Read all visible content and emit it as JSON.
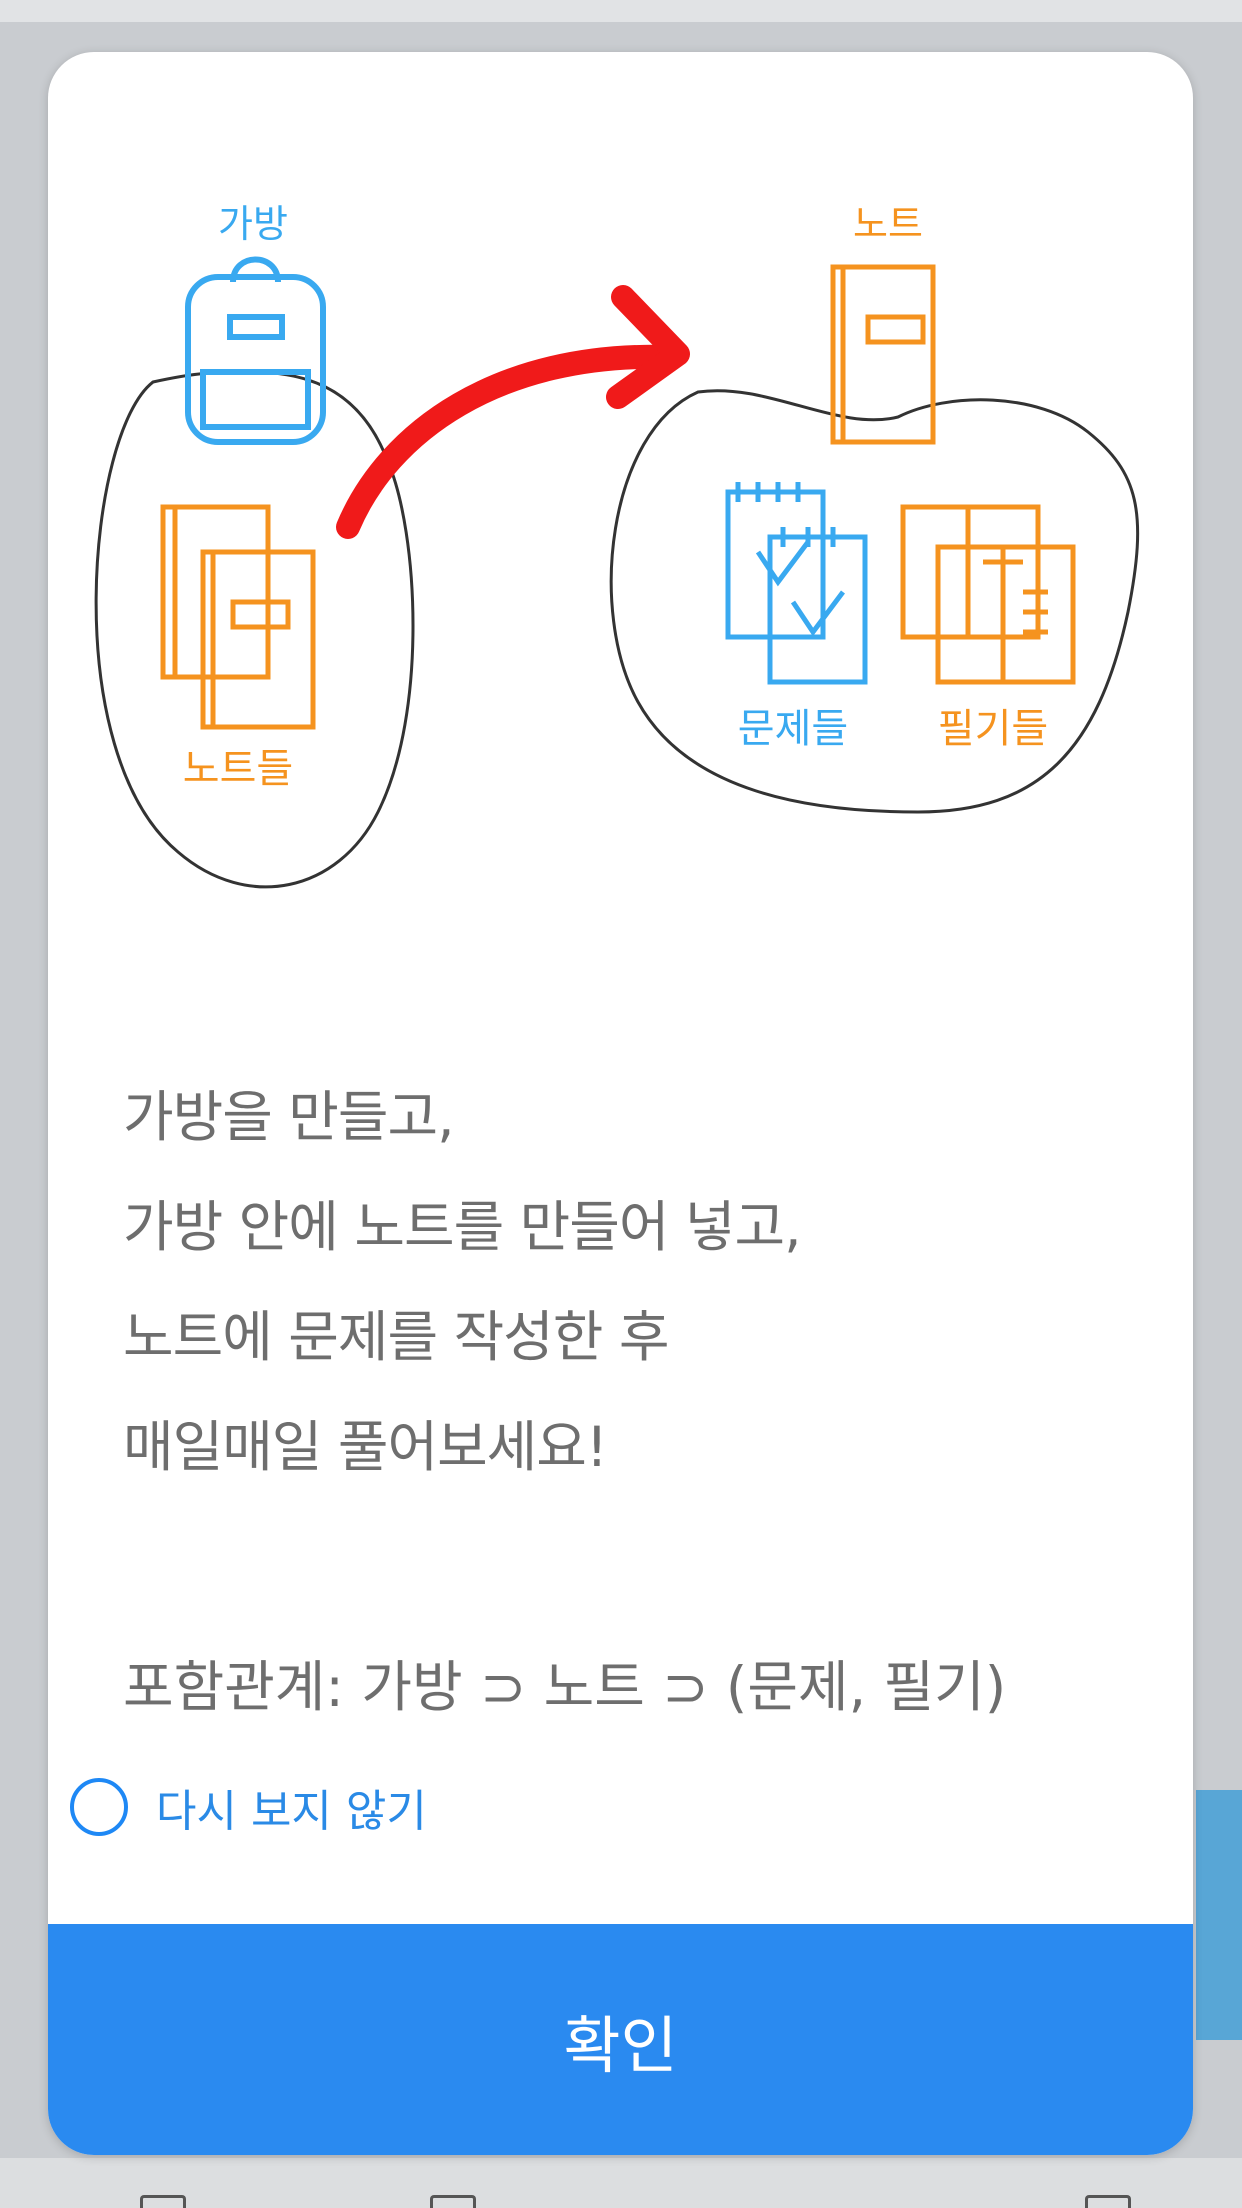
{
  "dialog": {
    "illustration": {
      "bag_label": "가방",
      "notes_label": "노트들",
      "note_label": "노트",
      "problems_label": "문제들",
      "memos_label": "필기들"
    },
    "message_lines": [
      "가방을 만들고,",
      "가방 안에 노트를 만들어 넣고,",
      "노트에 문제를 작성한 후",
      "매일매일 풀어보세요!"
    ],
    "relation_text": "포함관계: 가방 ⊃ 노트 ⊃ (문제, 필기)",
    "dont_show_label": "다시 보지 않기",
    "confirm_label": "확인"
  },
  "colors": {
    "accent_blue": "#2a8af0",
    "illustration_blue": "#39a9f0",
    "illustration_orange": "#f5931f",
    "arrow_red": "#f01a1a"
  }
}
